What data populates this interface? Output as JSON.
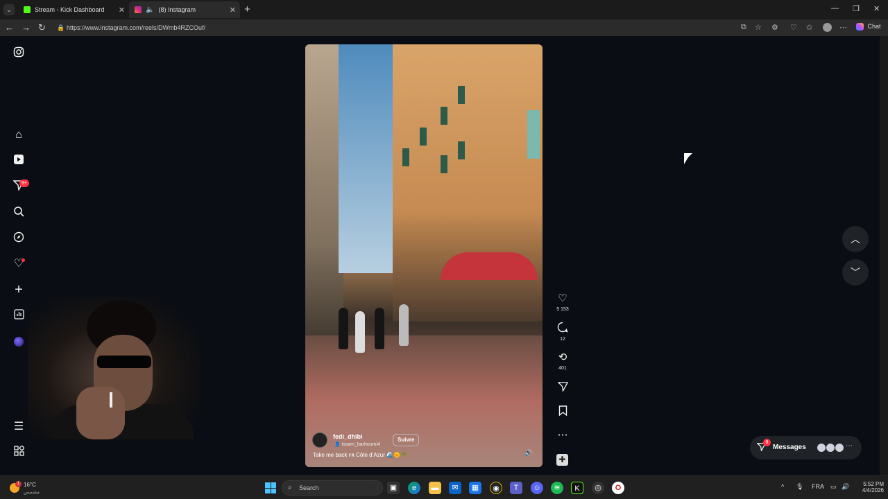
{
  "browser": {
    "tabs": [
      {
        "title": "Stream - Kick Dashboard",
        "favicon": "kick-icon"
      },
      {
        "title": "(8) Instagram",
        "favicon": "instagram-icon"
      }
    ],
    "url": "https://www.instagram.com/reels/DWmb4RZCOuf/",
    "chat_label": "Chat"
  },
  "sidebar": {
    "notifications_badge": "9+"
  },
  "reel": {
    "username": "fedi_dhibi",
    "collab_user": "issam_barhoumi4",
    "follow_label": "Suivre",
    "caption": "Take me back ꜰʀ Côte d’Azur 🌊🌞🌴",
    "likes": "5 153",
    "comments": "12",
    "reposts": "401"
  },
  "messages": {
    "label": "Messages",
    "badge": "8"
  },
  "taskbar": {
    "temperature": "16°C",
    "weather_text": "مشمس",
    "weather_badge": "1",
    "search_placeholder": "Search",
    "language": "FRA",
    "time": "5:52 PM",
    "date": "4/4/2026"
  }
}
